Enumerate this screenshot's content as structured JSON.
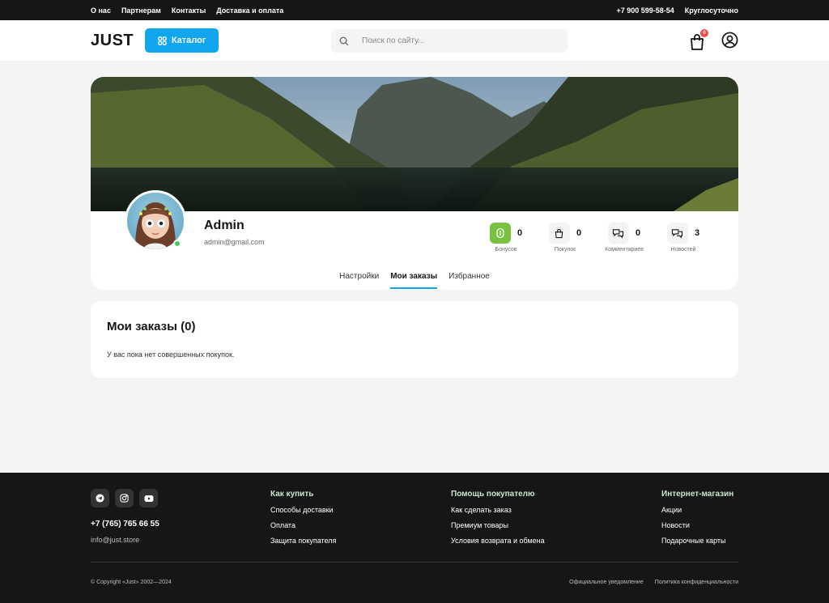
{
  "topbar": {
    "links": [
      "О нас",
      "Партнерам",
      "Контакты",
      "Доставка и оплата"
    ],
    "phone": "+7 900 599-58-54",
    "hours": "Круглосуточно"
  },
  "header": {
    "logo": "JUST",
    "catalog_label": "Каталог",
    "search_placeholder": "Поиск по сайту...",
    "cart_count": "0"
  },
  "profile": {
    "name": "Admin",
    "email": "admin@gmail.com",
    "stats": [
      {
        "value": "0",
        "label": "Бонусов",
        "icon": "bonus-icon"
      },
      {
        "value": "0",
        "label": "Покупок",
        "icon": "bag-icon"
      },
      {
        "value": "0",
        "label": "Комментариев",
        "icon": "comments-icon"
      },
      {
        "value": "3",
        "label": "Новостей",
        "icon": "news-icon"
      }
    ],
    "tabs": [
      {
        "label": "Настройки",
        "active": false
      },
      {
        "label": "Мои заказы",
        "active": true
      },
      {
        "label": "Избранное",
        "active": false
      }
    ]
  },
  "orders": {
    "title": "Мои заказы (0)",
    "empty_text": "У вас пока нет совершенных покупок."
  },
  "footer": {
    "socials": [
      "telegram-icon",
      "instagram-icon",
      "youtube-icon"
    ],
    "phone": "+7 (765) 765 66 55",
    "email": "info@just.store",
    "columns": [
      {
        "title": "Как купить",
        "links": [
          "Способы доставки",
          "Оплата",
          "Защита покупателя"
        ]
      },
      {
        "title": "Помощь покупателю",
        "links": [
          "Как сделать заказ",
          "Премиум товары",
          "Условия возврата и обмена"
        ]
      },
      {
        "title": "Интернет-магазин",
        "links": [
          "Акции",
          "Новости",
          "Подарочные карты"
        ]
      }
    ],
    "copyright": "© Copyright «Just» 2002—2024",
    "legal": [
      "Официальное уведомление",
      "Политика конфиденциальности"
    ]
  },
  "colors": {
    "accent": "#0fa6ee",
    "bonus_green": "#7ac142",
    "online": "#3ecf5a",
    "dark": "#161616"
  }
}
